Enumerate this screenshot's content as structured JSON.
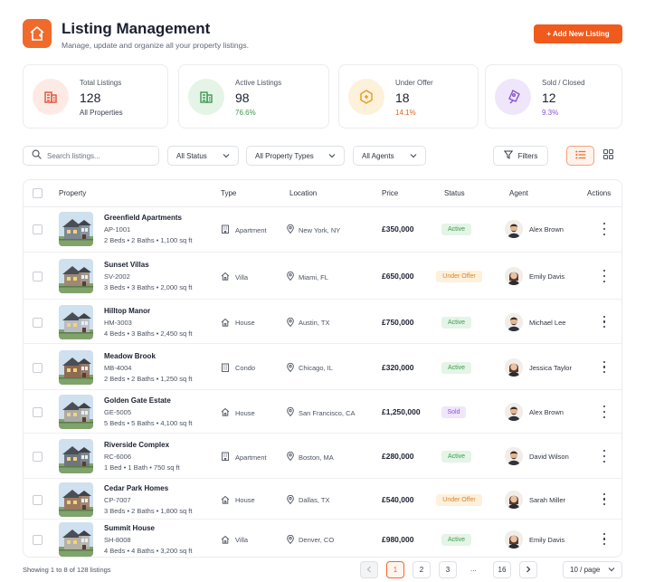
{
  "header": {
    "title": "Listing Management",
    "subtitle": "Manage, update and organize all your property listings.",
    "add_button": "+ Add New Listing"
  },
  "stats": [
    {
      "label": "Total Listings",
      "value": "128",
      "sub": "All Properties",
      "icon": "building-icon",
      "color": "#e0523a",
      "bg": "#fdeae4",
      "sub_color": "#3a4150"
    },
    {
      "label": "Active Listings",
      "value": "98",
      "sub": "76.6%",
      "icon": "building-icon",
      "color": "#3f9a52",
      "bg": "#e4f4e6",
      "sub_color": "#3f9a52"
    },
    {
      "label": "Under Offer",
      "value": "18",
      "sub": "14.1%",
      "icon": "tag-icon",
      "color": "#e39a1f",
      "bg": "#fdf1da",
      "sub_color": "#e0641f"
    },
    {
      "label": "Sold / Closed",
      "value": "12",
      "sub": "9.3%",
      "icon": "sold-tag-icon",
      "color": "#8a55d6",
      "bg": "#efe6fb",
      "sub_color": "#8a55d6"
    }
  ],
  "filters": {
    "search_placeholder": "Search listings...",
    "status": "All Status",
    "property_types": "All Property Types",
    "agents": "All Agents",
    "filters_button": "Filters"
  },
  "table": {
    "columns": {
      "property": "Property",
      "type": "Type",
      "location": "Location",
      "price": "Price",
      "status": "Status",
      "agent": "Agent",
      "actions": "Actions"
    },
    "rows": [
      {
        "name": "Greenfield Apartments",
        "code": "AP-1001",
        "beds": "2 Beds",
        "baths": "2 Baths",
        "area": "1,100 sq ft",
        "type": "Apartment",
        "type_icon": "apartment-icon",
        "location": "New York, NY",
        "price": "£350,000",
        "status": "Active",
        "status_kind": "active",
        "agent": "Alex Brown",
        "agent_gender": "m",
        "house_color": "#7d8893"
      },
      {
        "name": "Sunset Villas",
        "code": "SV-2002",
        "beds": "3 Beds",
        "baths": "3 Baths",
        "area": "2,000 sq ft",
        "type": "Villa",
        "type_icon": "villa-icon",
        "location": "Miami, FL",
        "price": "£650,000",
        "status": "Under Offer",
        "status_kind": "offer",
        "agent": "Emily Davis",
        "agent_gender": "f",
        "house_color": "#9a8a78"
      },
      {
        "name": "Hilltop Manor",
        "code": "HM-3003",
        "beds": "4 Beds",
        "baths": "3 Baths",
        "area": "2,450 sq ft",
        "type": "House",
        "type_icon": "house-icon",
        "location": "Austin, TX",
        "price": "£750,000",
        "status": "Active",
        "status_kind": "active",
        "agent": "Michael Lee",
        "agent_gender": "m",
        "house_color": "#b7bcc2"
      },
      {
        "name": "Meadow Brook",
        "code": "MB-4004",
        "beds": "2 Beds",
        "baths": "2 Baths",
        "area": "1,250 sq ft",
        "type": "Condo",
        "type_icon": "condo-icon",
        "location": "Chicago, IL",
        "price": "£320,000",
        "status": "Active",
        "status_kind": "active",
        "agent": "Jessica Taylor",
        "agent_gender": "f",
        "house_color": "#8c6a55"
      },
      {
        "name": "Golden Gate Estate",
        "code": "GE-5005",
        "beds": "5 Beds",
        "baths": "5 Baths",
        "area": "4,100 sq ft",
        "type": "House",
        "type_icon": "house-icon",
        "location": "San Francisco, CA",
        "price": "£1,250,000",
        "status": "Sold",
        "status_kind": "sold",
        "agent": "Alex Brown",
        "agent_gender": "m",
        "house_color": "#a9aaa6"
      },
      {
        "name": "Riverside Complex",
        "code": "RC-6006",
        "beds": "1 Bed",
        "baths": "1 Bath",
        "area": "750 sq ft",
        "type": "Apartment",
        "type_icon": "apartment-icon",
        "location": "Boston, MA",
        "price": "£280,000",
        "status": "Active",
        "status_kind": "active",
        "agent": "David Wilson",
        "agent_gender": "m",
        "house_color": "#6d7580"
      },
      {
        "name": "Cedar Park Homes",
        "code": "CP-7007",
        "beds": "3 Beds",
        "baths": "2 Baths",
        "area": "1,800 sq ft",
        "type": "House",
        "type_icon": "house-icon",
        "location": "Dallas, TX",
        "price": "£540,000",
        "status": "Under Offer",
        "status_kind": "offer",
        "agent": "Sarah Miller",
        "agent_gender": "f",
        "house_color": "#9b7a62"
      },
      {
        "name": "Summit House",
        "code": "SH-8008",
        "beds": "4 Beds",
        "baths": "4 Baths",
        "area": "3,200 sq ft",
        "type": "Villa",
        "type_icon": "villa-icon",
        "location": "Denver, CO",
        "price": "£980,000",
        "status": "Active",
        "status_kind": "active",
        "agent": "Emily Davis",
        "agent_gender": "f",
        "house_color": "#b5b0a8"
      }
    ]
  },
  "footer": {
    "showing": "Showing 1 to 8 of 128 listings",
    "pages": [
      "1",
      "2",
      "3"
    ],
    "ellipsis": "...",
    "last_page": "16",
    "per_page": "10 / page"
  },
  "colors": {
    "accent": "#f05a1c",
    "active_bg": "#e4f4e6",
    "active_fg": "#3c9a4c",
    "offer_bg": "#fdf0dc",
    "offer_fg": "#d9862a",
    "sold_bg": "#efe6fb",
    "sold_fg": "#8a55d6"
  }
}
